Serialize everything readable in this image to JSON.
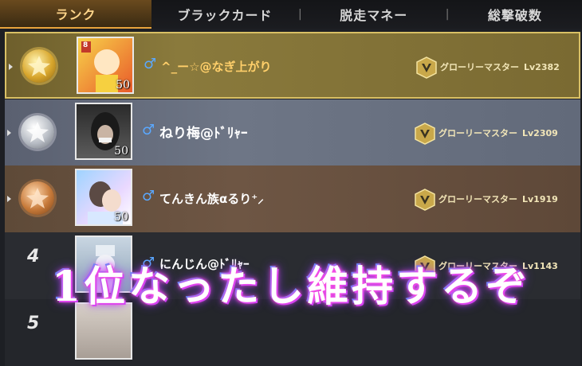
{
  "tabs": [
    {
      "label": "ランク",
      "active": true
    },
    {
      "label": "ブラックカード",
      "active": false
    },
    {
      "label": "脱走マネー",
      "active": false
    },
    {
      "label": "総撃破数",
      "active": false
    }
  ],
  "rows": [
    {
      "rank": "1",
      "medal": "gold-medal",
      "level": "50",
      "badge_level": "8",
      "name": "^_ー☆@なぎ上がり",
      "title": "グローリーマスター",
      "title_level": "Lv2382"
    },
    {
      "rank": "2",
      "medal": "silver-medal",
      "level": "50",
      "name": "ねり梅@ﾄﾞﾘｬｰ",
      "title": "グローリーマスター",
      "title_level": "Lv2309"
    },
    {
      "rank": "3",
      "medal": "bronze-medal",
      "level": "50",
      "name": "てんきん族αるり⁺⸝",
      "title": "グローリーマスター",
      "title_level": "Lv1919"
    },
    {
      "rank": "4",
      "name": "にんじん@ﾄﾞﾘｬｰ",
      "title": "グローリーマスター",
      "title_level": "Lv1143"
    },
    {
      "rank": "5"
    }
  ],
  "overlay_text": "1位なったし維持するぞ",
  "colors": {
    "accent": "#e9a43d",
    "gender": "#5aa8ff",
    "overlay_glow": "#ff4de1"
  }
}
